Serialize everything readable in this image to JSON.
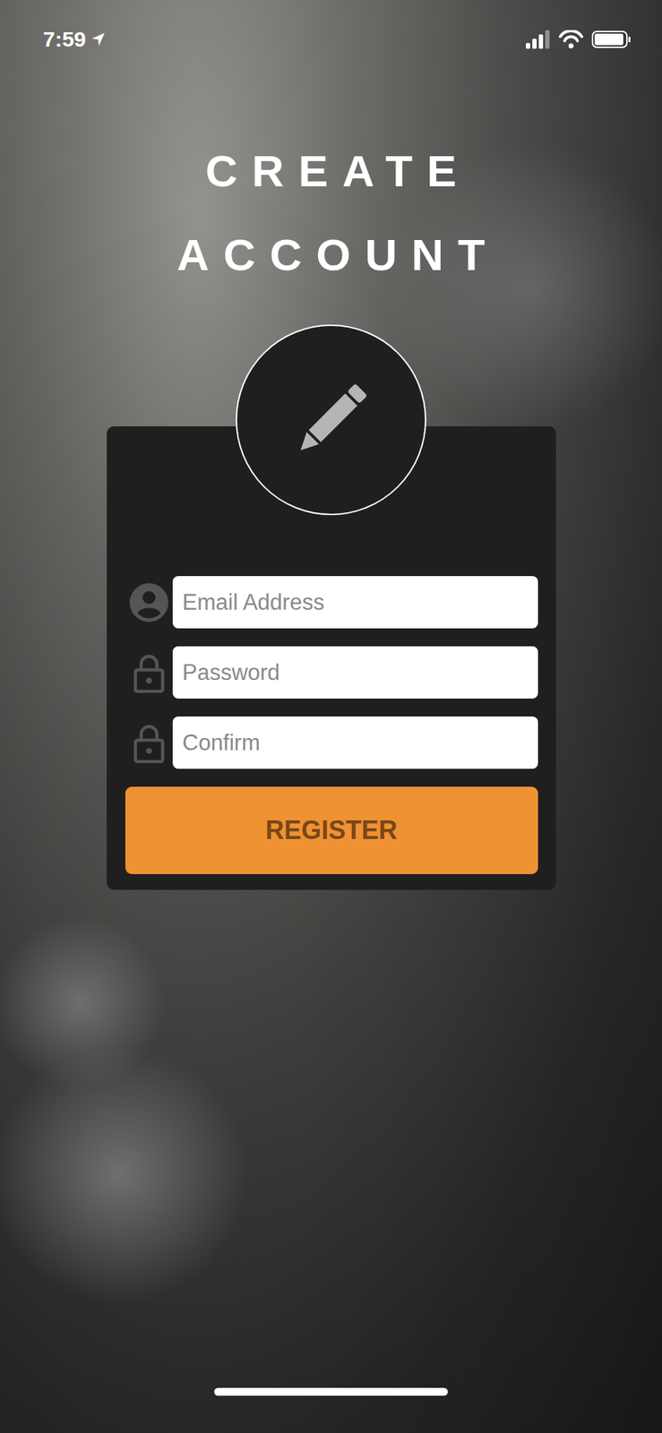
{
  "status_bar": {
    "time": "7:59",
    "signal": 0.75,
    "battery": 0.95
  },
  "title": [
    "CREATE",
    "ACCOUNT"
  ],
  "fields": [
    {
      "kind": "email",
      "placeholder": "Email Address"
    },
    {
      "kind": "password",
      "placeholder": "Password"
    },
    {
      "kind": "password",
      "placeholder": "Confirm"
    }
  ],
  "button": "REGISTER"
}
